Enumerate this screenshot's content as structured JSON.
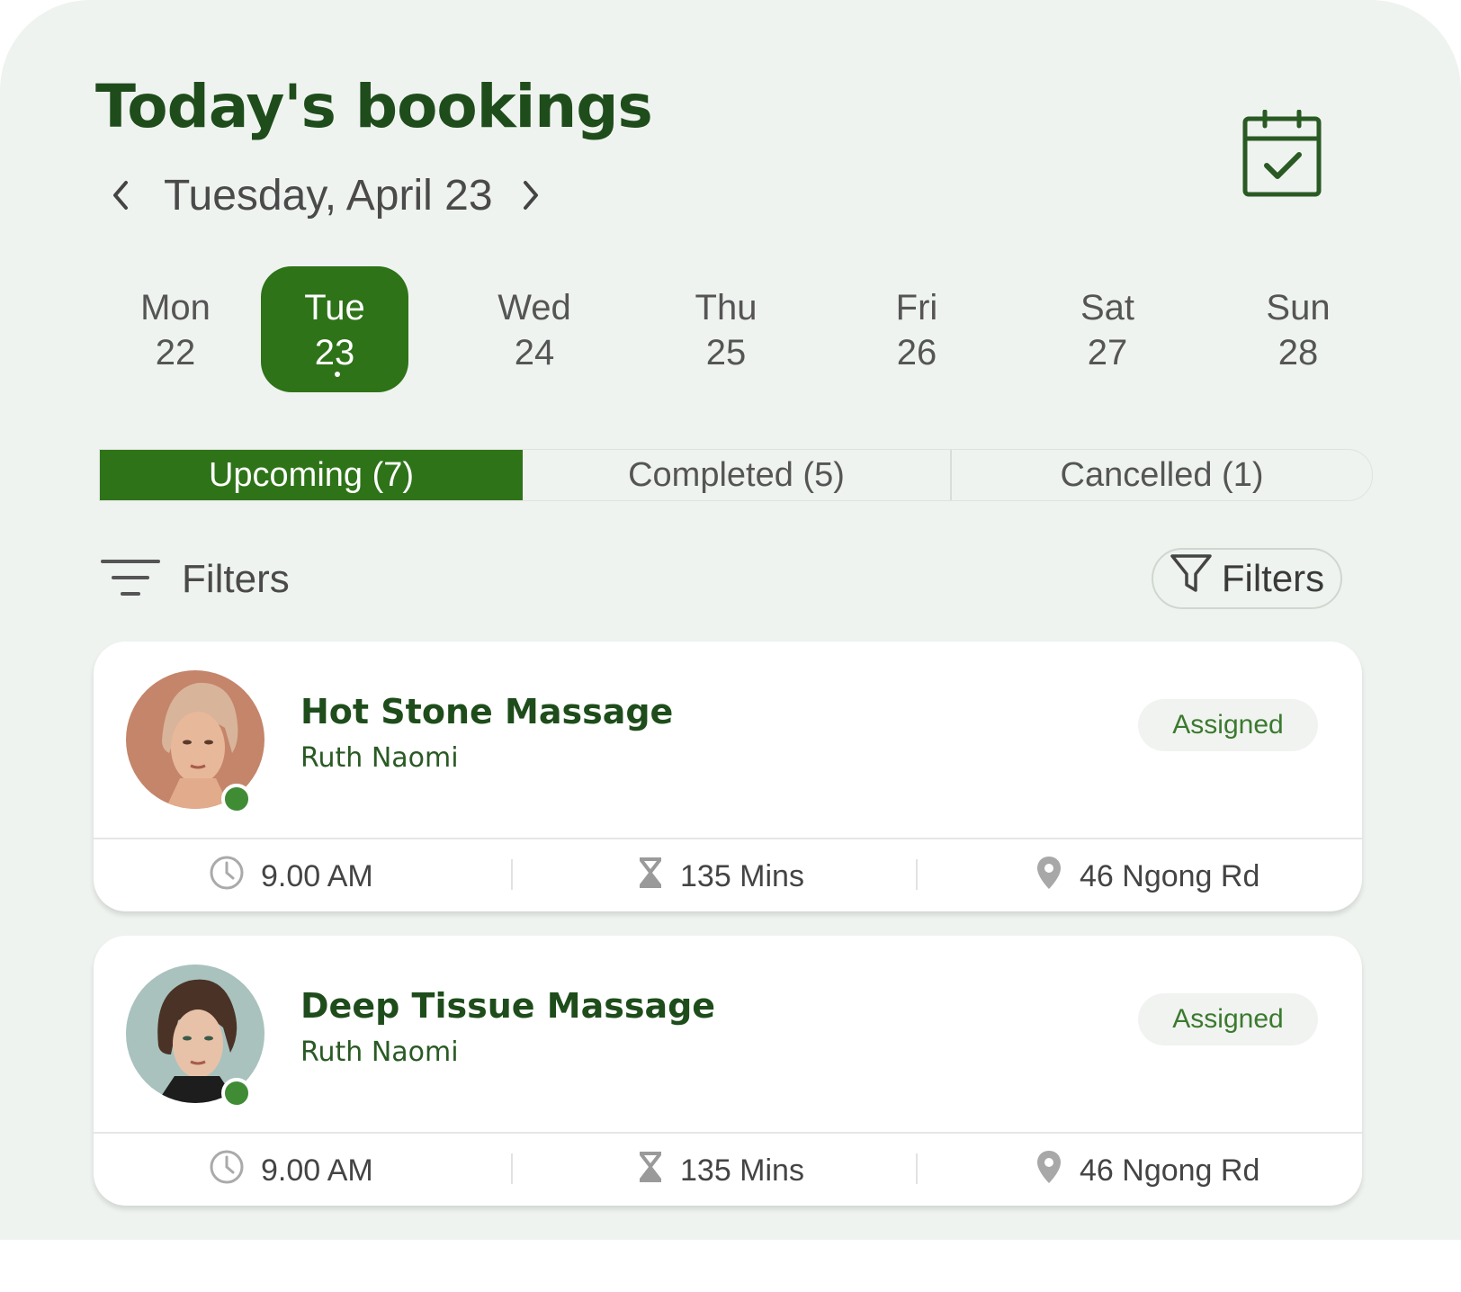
{
  "header": {
    "title": "Today's bookings",
    "date_label": "Tuesday, April 23"
  },
  "icons": {
    "prev": "chevron-left-icon",
    "next": "chevron-right-icon",
    "calendar": "calendar-check-icon",
    "sort": "sort-lines-icon",
    "funnel": "funnel-icon",
    "clock": "clock-icon",
    "duration": "hourglass-icon",
    "location": "location-pin-icon"
  },
  "week": [
    {
      "name": "Mon",
      "num": "22"
    },
    {
      "name": "Tue",
      "num": "23",
      "selected": true
    },
    {
      "name": "Wed",
      "num": "24"
    },
    {
      "name": "Thu",
      "num": "25"
    },
    {
      "name": "Fri",
      "num": "26"
    },
    {
      "name": "Sat",
      "num": "27"
    },
    {
      "name": "Sun",
      "num": "28"
    }
  ],
  "tabs": [
    {
      "label": "Upcoming (7)",
      "active": true
    },
    {
      "label": "Completed (5)"
    },
    {
      "label": "Cancelled (1)"
    }
  ],
  "filters": {
    "left_label": "Filters",
    "button_label": "Filters"
  },
  "bookings": [
    {
      "service": "Hot Stone Massage",
      "client": "Ruth Naomi",
      "status": "Assigned",
      "time": "9.00 AM",
      "duration": "135 Mins",
      "location": "46 Ngong Rd"
    },
    {
      "service": "Deep Tissue Massage",
      "client": "Ruth Naomi",
      "status": "Assigned",
      "time": "9.00 AM",
      "duration": "135 Mins",
      "location": "46 Ngong Rd"
    }
  ],
  "colors": {
    "accent": "#2e7318",
    "title": "#1e4d1b",
    "background": "#eff3ef",
    "online": "#3f8c35"
  }
}
